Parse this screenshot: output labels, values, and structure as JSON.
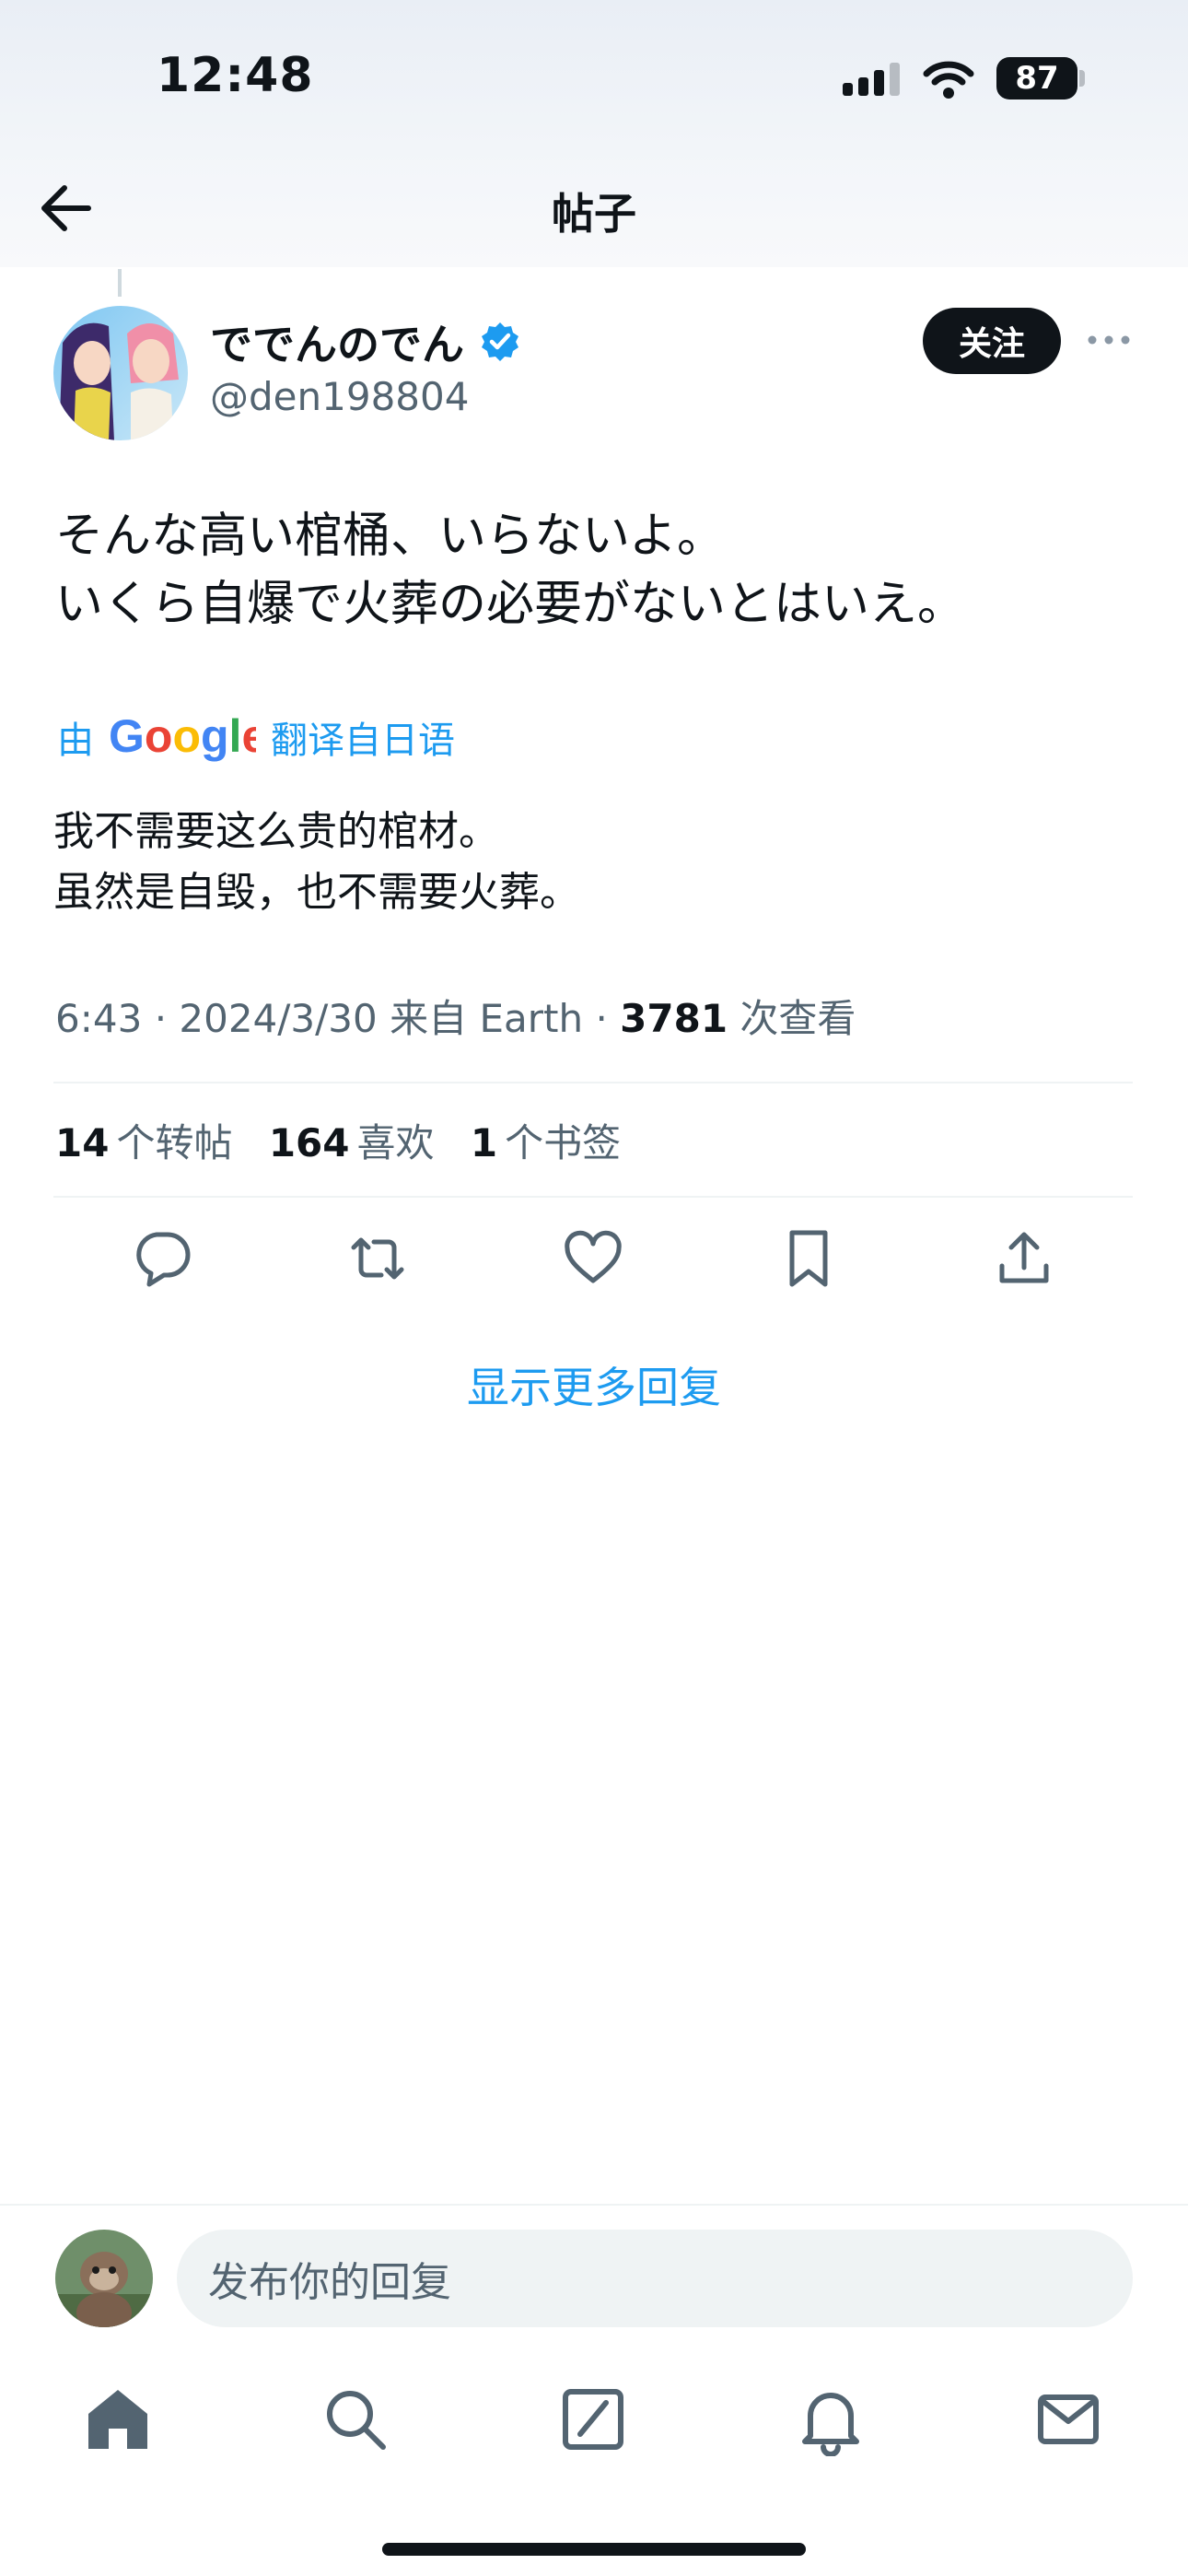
{
  "status_bar": {
    "time": "12:48",
    "battery": "87",
    "icons": [
      "signal-icon",
      "wifi-icon",
      "battery-icon"
    ]
  },
  "header": {
    "title": "帖子",
    "back_icon": "arrow-left-icon"
  },
  "tweet": {
    "author": {
      "display_name": "ででんのでん",
      "handle": "@den198804",
      "verified": true
    },
    "follow_label": "关注",
    "text_lines": [
      "そんな高い棺桶、いらないよ。",
      "いくら自爆で火葬の必要がないとはいえ。"
    ],
    "translation": {
      "prefix": "由",
      "provider": "Google",
      "suffix": "翻译自日语",
      "lines": [
        "我不需要这么贵的棺材。",
        "虽然是自毁，也不需要火葬。"
      ]
    },
    "meta": {
      "time": "6:43",
      "date": "2024/3/30",
      "source": "来自 Earth",
      "views": "3781",
      "views_label": "次查看"
    },
    "stats": {
      "reposts": "14",
      "reposts_label": "个转帖",
      "likes": "164",
      "likes_label": "喜欢",
      "bookmarks": "1",
      "bookmarks_label": "个书签"
    },
    "actions": [
      "reply-icon",
      "repost-icon",
      "like-icon",
      "bookmark-icon",
      "share-icon"
    ]
  },
  "show_more_replies": "显示更多回复",
  "reply_bar": {
    "placeholder": "发布你的回复"
  },
  "bottom_nav": [
    "home-icon",
    "search-icon",
    "grok-icon",
    "notifications-icon",
    "messages-icon"
  ],
  "colors": {
    "accent": "#1d9bf0",
    "text": "#0f1419",
    "secondary": "#536471"
  }
}
